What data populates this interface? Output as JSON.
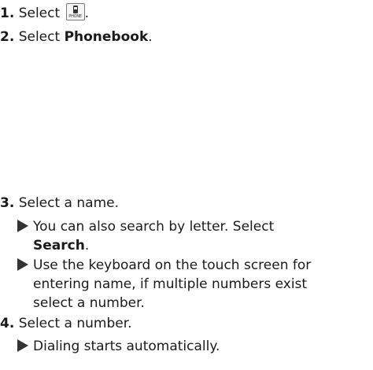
{
  "steps": [
    {
      "number": "1.",
      "text_before": "Select ",
      "icon": "phone-button-icon",
      "icon_label": "PHONE",
      "text_after": "."
    },
    {
      "number": "2.",
      "text_before": "Select ",
      "bold": "Phonebook",
      "text_after": "."
    },
    {
      "number": "3.",
      "text": "Select a name.",
      "notes": [
        {
          "line1": "You can also search by letter. Select",
          "line2_bold": "Search",
          "line2_after": "."
        },
        {
          "line1": "Use the keyboard on the touch screen for",
          "line2": "entering name, if multiple numbers exist",
          "line3": "select a number."
        }
      ]
    },
    {
      "number": "4.",
      "text": "Select a number.",
      "notes": [
        {
          "line1": "Dialing starts automatically."
        }
      ]
    }
  ]
}
